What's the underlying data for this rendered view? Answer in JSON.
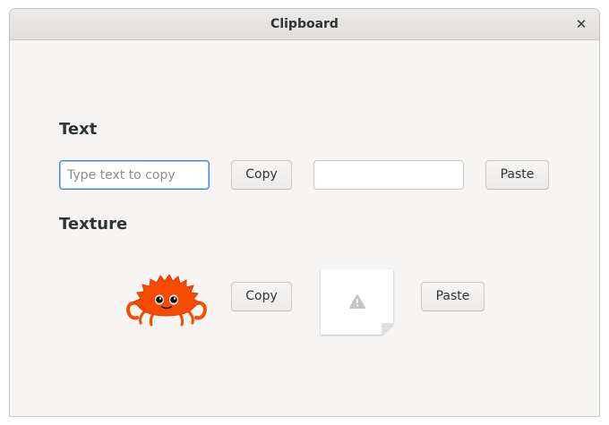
{
  "window": {
    "title": "Clipboard"
  },
  "text_section": {
    "heading": "Text",
    "copy_input_placeholder": "Type text to copy",
    "copy_input_value": "",
    "copy_label": "Copy",
    "paste_output_value": "",
    "paste_label": "Paste"
  },
  "texture_section": {
    "heading": "Texture",
    "source_image": "rust-crab-ferris-icon",
    "copy_label": "Copy",
    "target_image": "missing-image-icon",
    "paste_label": "Paste"
  },
  "colors": {
    "window_bg": "#f6f5f4",
    "focus_accent": "#3584e4",
    "crab_orange": "#f74c00"
  }
}
